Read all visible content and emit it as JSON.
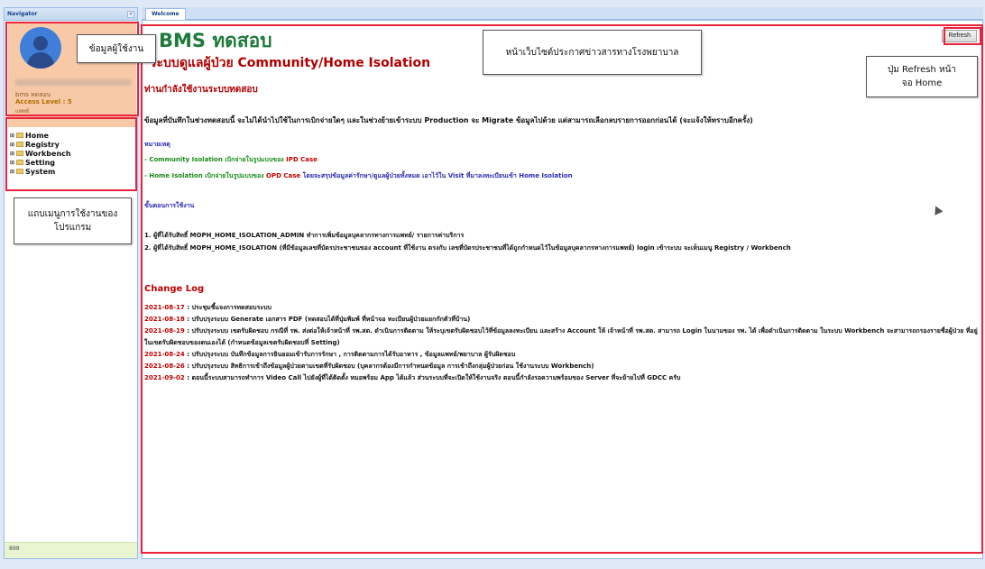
{
  "navigator": {
    "title": "Navigator",
    "collapse_icon": "«",
    "user": {
      "name": "bms ทดสอบ",
      "access_level": "Access Level : 5",
      "role": "แพทย์"
    },
    "menu": [
      {
        "label": "Home"
      },
      {
        "label": "Registry"
      },
      {
        "label": "Workbench"
      },
      {
        "label": "Setting"
      },
      {
        "label": "System"
      }
    ],
    "footer": "899"
  },
  "tabs": [
    {
      "label": "Welcome"
    }
  ],
  "main": {
    "title1": "BMS ทดสอบ",
    "title2": "ระบบดูแลผู้ป่วย Community/Home Isolation",
    "refresh_label": "Refresh",
    "status_heading": "ท่านกำลังใช้งานระบบทดสอบ",
    "notice": "ข้อมูลที่บันทึกในช่วงทดสอบนี้ จะไม่ได้นำไปใช้ในการเบิกจ่ายใดๆ และในช่วงย้ายเข้าระบบ Production จะ Migrate ข้อมูลไปด้วย แต่สามารถเลือกลบรายการออกก่อนได้ (จะแจ้งให้ทราบอีกครั้ง)",
    "remark_heading": "หมายเหตุ",
    "remark1": {
      "a": "- Community Isolation เบิกจ่ายในรูปแบบของ ",
      "b": "IPD Case"
    },
    "remark2": {
      "a": "- Home Isolation เบิกจ่ายในรูปแบบของ ",
      "b": "OPD Case",
      "c": " โดยจะสรุปข้อมูลค่ารักษา/ดูแลผู้ป่วยทั้งหมด เอาไว้ใน Visit ที่มาลงทะเบียนเข้า Home Isolation"
    },
    "steps_heading": "ขั้นตอนการใช้งาน",
    "step1": "1. ผู้ที่ได้รับสิทธิ์ MOPH_HOME_ISOLATION_ADMIN ทำการเพิ่มข้อมูลบุคลากรทางการแพทย์/ รายการค่าบริการ",
    "step2": "2. ผู้ที่ได้รับสิทธิ์ MOPH_HOME_ISOLATION (ที่มีข้อมูลเลขที่บัตรประชาชนของ account ที่ใช้งาน ตรงกับ เลขที่บัตรประชาชนที่ได้ถูกกำหนดไว้ในข้อมูลบุคลากรทางการแพทย์) login เข้าระบบ จะเห็นเมนู Registry / Workbench",
    "changelog_heading": "Change Log",
    "changelog": [
      {
        "date": "2021-08-17",
        "text": " : ประชุมชี้แจงการทดสอบระบบ"
      },
      {
        "date": "2021-08-18",
        "text": " : ปรับปรุงระบบ Generate เอกสาร PDF (ทดสอบได้ที่ปุ่มพิมพ์ ที่หน้าจอ ทะเบียนผู้ป่วยแยกกักตัวที่บ้าน)"
      },
      {
        "date": "2021-08-19",
        "text": " : ปรับปรุงระบบ เขตรับผิดชอบ กรณีที่ รพ. ส่งต่อให้เจ้าหน้าที่ รพ.สต. ดำเนินการติดตาม ให้ระบุเขตรับผิดชอบไว้ที่ข้อมูลลงทะเบียน และสร้าง Account ให้ เจ้าหน้าที่ รพ.สต. สามารถ Login ในนามของ รพ. ได้ เพื่อดำเนินการติดตาม ในระบบ Workbench จะสามารถกรองรายชื่อผู้ป่วย ที่อยู่ในเขตรับผิดชอบของตนเองได้ (กำหนดข้อมูลเขตรับผิดชอบที่ Setting)"
      },
      {
        "date": "2021-08-24",
        "text": " : ปรับปรุงระบบ บันทึกข้อมูลการยินยอมเข้ารับการรักษา , การติดตามการได้รับอาหาร , ข้อมูลแพทย์/พยาบาล ผู้รับผิดชอบ"
      },
      {
        "date": "2021-08-26",
        "text": " : ปรับปรุงระบบ สิทธิการเข้าถึงข้อมูลผู้ป่วยตามเขตที่รับผิดชอบ (บุคลากรต้องมีการกำหนดข้อมูล การเข้าถึงกลุ่มผู้ป่วยก่อน ใช้งานระบบ Workbench)"
      },
      {
        "date": "2021-09-02",
        "text": " : ตอนนี้ระบบสามารถทำการ Video Call ไปยังผู้ที่ได้ติดตั้ง หมอพร้อม App ได้แล้ว ส่วนระบบที่จะเปิดให้ใช้งานจริง ตอนนี้กำลังรอความพร้อมของ Server ที่จะย้ายไปที่ GDCC ครับ"
      }
    ]
  },
  "annotations": {
    "user_info": "ข้อมูลผู้ใช้งาน",
    "menu_bar": "แถบเมนูการใช้งานของโปรแกรม",
    "news_page": "หน้าเว็บไซต์ประกาศข่าวสารทางโรงพยาบาล",
    "refresh_note": "ปุ่ม Refresh หน้าจอ Home"
  },
  "colors": {
    "accent_red": "#e8233b",
    "title_green": "#1e7a3a",
    "panel_blue": "#99bbe8",
    "user_box": "#f8c9a6"
  }
}
